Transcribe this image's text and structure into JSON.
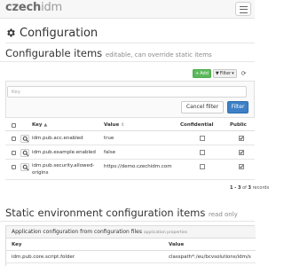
{
  "navbar": {
    "brand_part1": "czech",
    "brand_part2": "idm"
  },
  "page": {
    "title": "Configuration"
  },
  "configurable": {
    "title": "Configurable items",
    "subtitle": "editable, can override static items",
    "toolbar": {
      "add_label": "Add",
      "filter_label": "Filter"
    },
    "filter": {
      "key_placeholder": "Key",
      "cancel_label": "Cancel filter",
      "apply_label": "Filter"
    },
    "columns": {
      "key": "Key",
      "value": "Value",
      "confidential": "Confidential",
      "public": "Public"
    },
    "rows": [
      {
        "key": "idm.pub.acc.enabled",
        "value": "true",
        "confidential": false,
        "public": true
      },
      {
        "key": "idm.pub.example.enabled",
        "value": "false",
        "confidential": false,
        "public": true
      },
      {
        "key_line1": "idm.pub.security.allowed-",
        "key_line2": "origins",
        "value": "https://demo.czechidm.com",
        "confidential": false,
        "public": true
      }
    ],
    "pagination": {
      "range": "1 - 3",
      "of": "of",
      "total": "3",
      "unit": "records"
    }
  },
  "static_env": {
    "title": "Static environment configuration items",
    "subtitle": "read only",
    "panel_title": "Application configuration from configuration files",
    "panel_subtitle": "application properties",
    "columns": {
      "key": "Key",
      "value": "Value"
    },
    "rows": [
      {
        "key": "idm.pub.core.script.folder",
        "value": "classpath*:/eu/bcvsolutions/idm/s"
      }
    ]
  },
  "colors": {
    "add_button": "#5cb85c",
    "primary_button": "#3d80c6",
    "navbar_bg": "#f7f7f7"
  }
}
